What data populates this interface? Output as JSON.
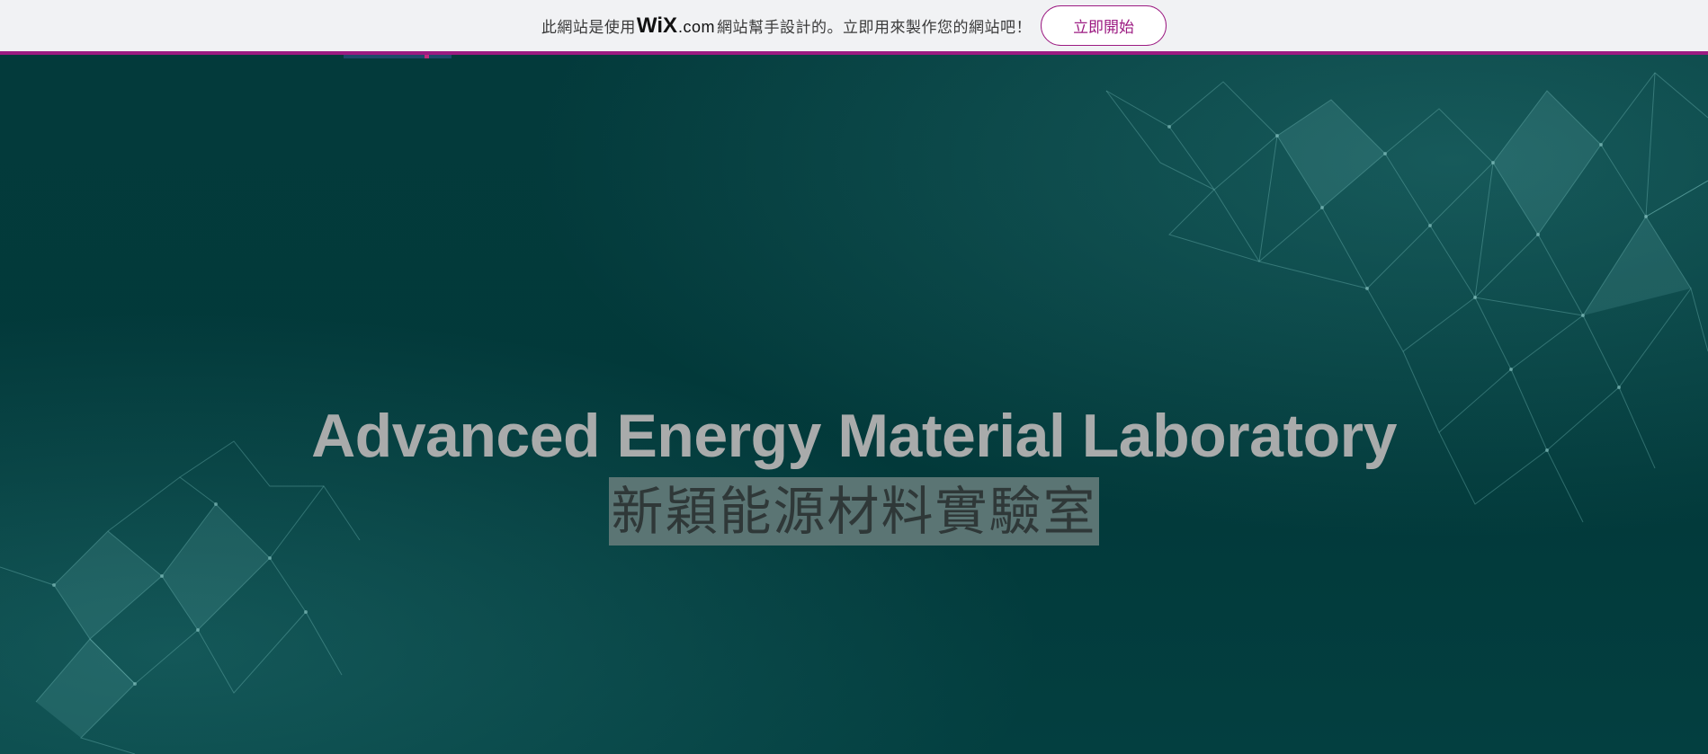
{
  "banner": {
    "message_prefix": "此網站是使用",
    "wix_logo": "WiX",
    "wix_domain": ".com",
    "message_suffix": "網站幫手設計的。立即用來製作您的網站吧！",
    "cta_label": "立即開始",
    "accent_color": "#9c1b82"
  },
  "hero": {
    "title": "Advanced Energy Material Laboratory",
    "subtitle": "新穎能源材料實驗室",
    "background_color": "#02393a"
  }
}
